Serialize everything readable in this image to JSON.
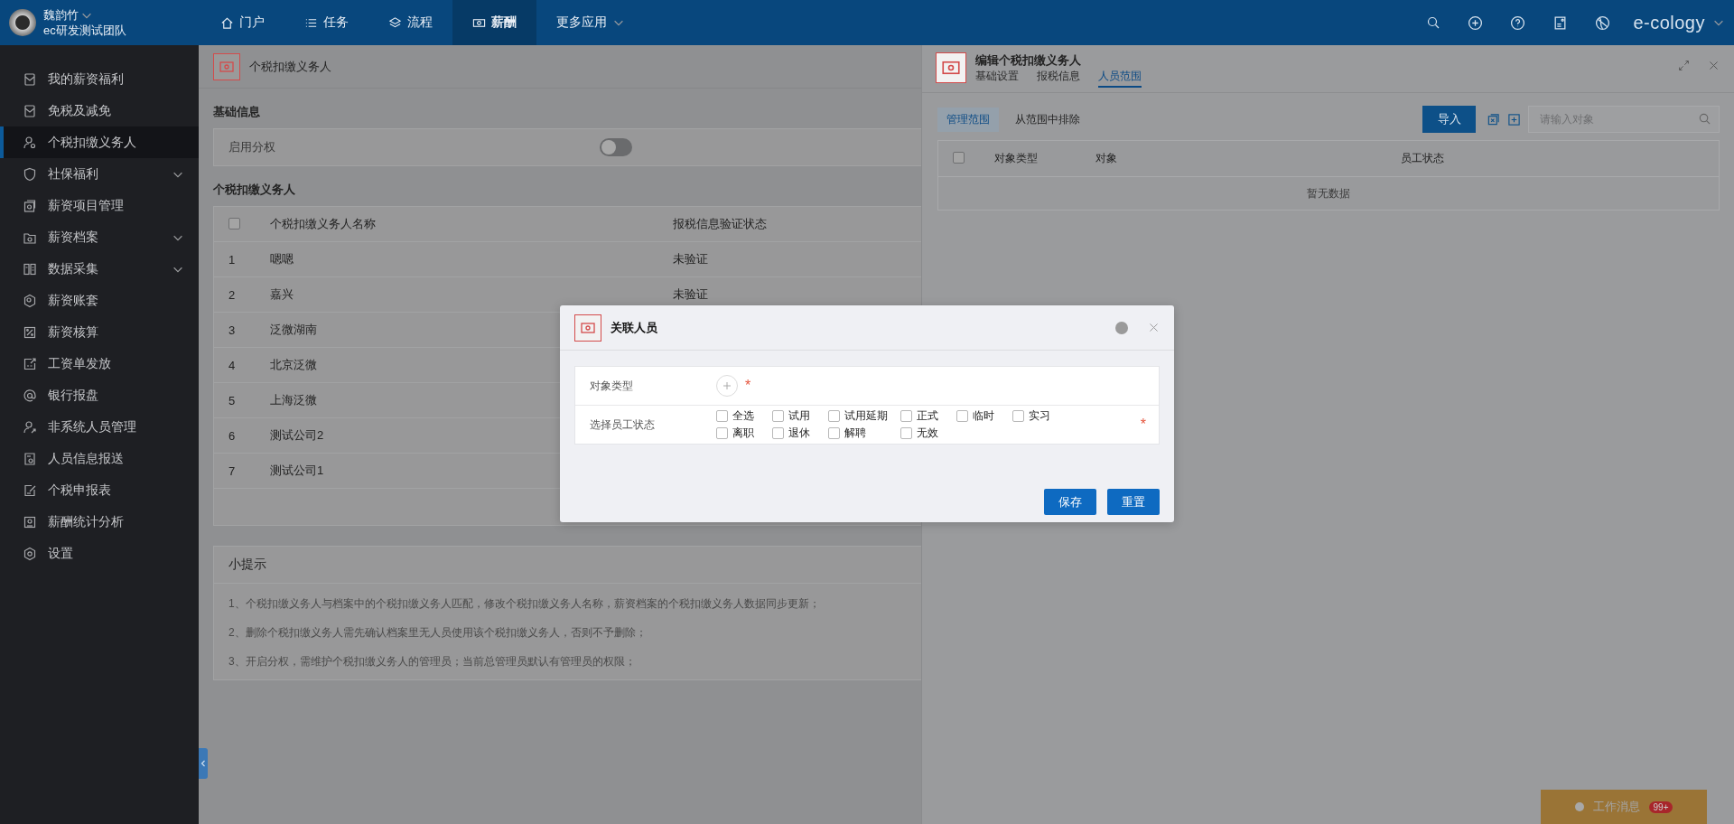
{
  "topbar": {
    "user": {
      "name": "魏韵竹",
      "team": "ec研发测试团队"
    },
    "nav": [
      {
        "label": "门户",
        "selected": false,
        "dropdown": false
      },
      {
        "label": "任务",
        "selected": false,
        "dropdown": false
      },
      {
        "label": "流程",
        "selected": false,
        "dropdown": false
      },
      {
        "label": "薪酬",
        "selected": true,
        "dropdown": false
      },
      {
        "label": "更多应用",
        "selected": false,
        "dropdown": true
      }
    ],
    "brand": "e-cology"
  },
  "sidebar": {
    "items": [
      {
        "label": "我的薪资福利",
        "selected": false,
        "expandable": false
      },
      {
        "label": "免税及减免",
        "selected": false,
        "expandable": false
      },
      {
        "label": "个税扣缴义务人",
        "selected": true,
        "expandable": false
      },
      {
        "label": "社保福利",
        "selected": false,
        "expandable": true
      },
      {
        "label": "薪资项目管理",
        "selected": false,
        "expandable": false
      },
      {
        "label": "薪资档案",
        "selected": false,
        "expandable": true
      },
      {
        "label": "数据采集",
        "selected": false,
        "expandable": true
      },
      {
        "label": "薪资账套",
        "selected": false,
        "expandable": false
      },
      {
        "label": "薪资核算",
        "selected": false,
        "expandable": false
      },
      {
        "label": "工资单发放",
        "selected": false,
        "expandable": false
      },
      {
        "label": "银行报盘",
        "selected": false,
        "expandable": false
      },
      {
        "label": "非系统人员管理",
        "selected": false,
        "expandable": false
      },
      {
        "label": "人员信息报送",
        "selected": false,
        "expandable": false
      },
      {
        "label": "个税申报表",
        "selected": false,
        "expandable": false
      },
      {
        "label": "薪酬统计分析",
        "selected": false,
        "expandable": false
      },
      {
        "label": "设置",
        "selected": false,
        "expandable": false
      }
    ]
  },
  "page": {
    "title": "个税扣缴义务人",
    "basic_title": "基础信息",
    "setting": {
      "label": "启用分权",
      "on": false
    },
    "list_title": "个税扣缴义务人",
    "table": {
      "header_checked": false,
      "columns": [
        "个税扣缴义务人名称",
        "报税信息验证状态"
      ],
      "rows": [
        {
          "index": "1",
          "name": "嗯嗯",
          "status": "未验证"
        },
        {
          "index": "2",
          "name": "嘉兴",
          "status": "未验证"
        },
        {
          "index": "3",
          "name": "泛微湖南"
        },
        {
          "index": "4",
          "name": "北京泛微"
        },
        {
          "index": "5",
          "name": "上海泛微"
        },
        {
          "index": "6",
          "name": "测试公司2"
        },
        {
          "index": "7",
          "name": "测试公司1"
        }
      ]
    },
    "tips": {
      "title": "小提示",
      "lines": [
        "1、个税扣缴义务人与档案中的个税扣缴义务人匹配，修改个税扣缴义务人名称，薪资档案的个税扣缴义务人数据同步更新；",
        "2、删除个税扣缴义务人需先确认档案里无人员使用该个税扣缴义务人，否则不予删除；",
        "3、开启分权，需维护个税扣缴义务人的管理员；当前总管理员默认有管理员的权限；"
      ]
    }
  },
  "panel": {
    "title": "编辑个税扣缴义务人",
    "tabs": [
      {
        "label": "基础设置",
        "selected": false
      },
      {
        "label": "报税信息",
        "selected": false
      },
      {
        "label": "人员范围",
        "selected": true
      }
    ],
    "subtabs": [
      {
        "label": "管理范围",
        "selected": true
      },
      {
        "label": "从范围中排除",
        "selected": false
      }
    ],
    "import_button": "导入",
    "search": {
      "placeholder": "请输入对象"
    },
    "table": {
      "header_checked": false,
      "columns": [
        "对象类型",
        "对象",
        "员工状态"
      ],
      "empty_text": "暂无数据"
    }
  },
  "modal": {
    "title": "关联人员",
    "fields": [
      {
        "kind": "add",
        "label": "对象类型",
        "marker": "*"
      },
      {
        "kind": "checkboxes",
        "label": "选择员工状态",
        "marker": "*",
        "options": [
          {
            "label": "全选",
            "checked": false
          },
          {
            "label": "试用",
            "checked": false
          },
          {
            "label": "试用延期",
            "checked": false
          },
          {
            "label": "正式",
            "checked": false
          },
          {
            "label": "临时",
            "checked": false
          },
          {
            "label": "实习",
            "checked": false
          },
          {
            "label": "离职",
            "checked": false
          },
          {
            "label": "退休",
            "checked": false
          },
          {
            "label": "解聘",
            "checked": false
          },
          {
            "label": "无效",
            "checked": false
          }
        ]
      }
    ],
    "buttons": [
      "保存",
      "重置"
    ]
  },
  "notification": {
    "label": "工作消息",
    "badge": "99+"
  }
}
